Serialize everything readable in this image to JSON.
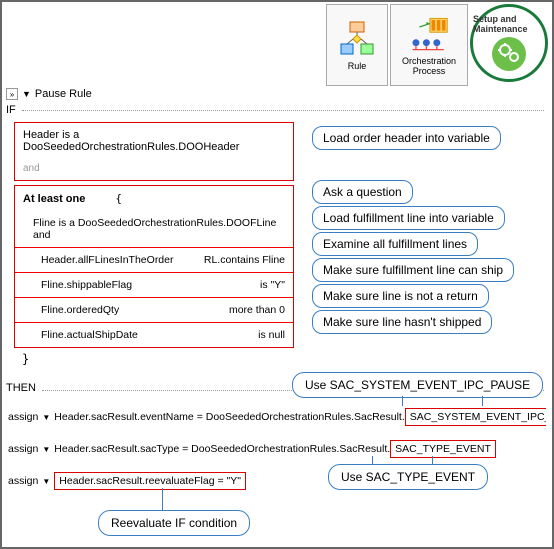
{
  "toolbar": {
    "rule": "Rule",
    "orchestration": "Orchestration Process",
    "setup": "Setup and Maintenance"
  },
  "topRow": {
    "expand": "»",
    "pauseRule": "Pause Rule"
  },
  "ifLabel": "IF",
  "headerRow": {
    "text": "Header is a  DooSeededOrchestrationRules.DOOHeader",
    "and": "and"
  },
  "atLeast": {
    "label": "At least one",
    "brace": "{",
    "flineRow": "Fline    is a DooSeededOrchestrationRules.DOOFLine   and",
    "rows": [
      {
        "left": "Header.allFLinesInTheOrder",
        "right": "RL.contains  Fline"
      },
      {
        "left": "Fline.shippableFlag",
        "right": "is  \"Y\""
      },
      {
        "left": "Fline.orderedQty",
        "right": "more than  0"
      },
      {
        "left": "Fline.actualShipDate",
        "right": "is  null"
      }
    ],
    "closeBrace": "}"
  },
  "annotations": {
    "a1": "Load order header into variable",
    "a2": "Ask a question",
    "a3": "Load fulfillment line into variable",
    "a4": "Examine all fulfillment lines",
    "a5": "Make sure fulfillment line can ship",
    "a6": "Make sure line is not a return",
    "a7": "Make sure line hasn't shipped"
  },
  "thenLabel": "THEN",
  "assigns": {
    "label": "assign",
    "tri": "▼",
    "row1_left": "Header.sacResult.eventName  = DooSeededOrchestrationRules.SacResult.",
    "row1_box": "SAC_SYSTEM_EVENT_IPC_PAUSE",
    "row2_left": "Header.sacResult.sacType  = DooSeededOrchestrationRules.SacResult.",
    "row2_box": "SAC_TYPE_EVENT",
    "row3_box": "Header.sacResult.reevaluateFlag   = \"Y\""
  },
  "callouts": {
    "c1": "Use SAC_SYSTEM_EVENT_IPC_PAUSE",
    "c2": "Use SAC_TYPE_EVENT",
    "c3": "Reevaluate  IF condition"
  }
}
